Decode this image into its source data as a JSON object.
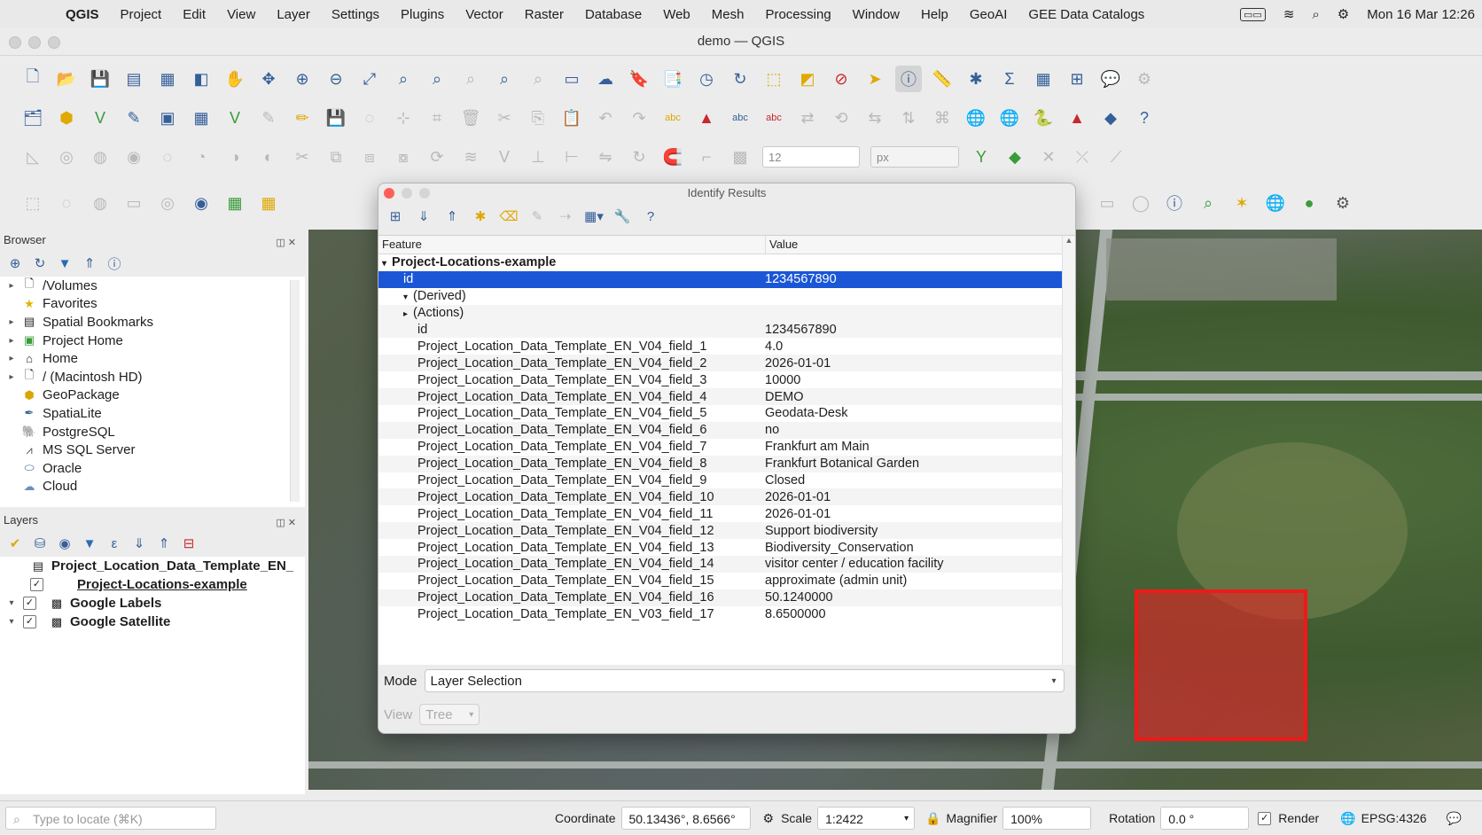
{
  "menubar": {
    "app_name": "QGIS",
    "items": [
      "Project",
      "Edit",
      "View",
      "Layer",
      "Settings",
      "Plugins",
      "Vector",
      "Raster",
      "Database",
      "Web",
      "Mesh",
      "Processing",
      "Window",
      "Help",
      "GeoAI",
      "GEE Data Catalogs"
    ],
    "clock": "Mon 16 Mar  12:26"
  },
  "window": {
    "title": "demo — QGIS"
  },
  "toolbar": {
    "size_value": "12",
    "size_unit": "px"
  },
  "browser": {
    "title": "Browser",
    "items": [
      {
        "label": "/Volumes",
        "icon": "folder-icon",
        "arrow": "▸"
      },
      {
        "label": "Favorites",
        "icon": "star-icon",
        "arrow": ""
      },
      {
        "label": "Spatial Bookmarks",
        "icon": "bookmark-icon",
        "arrow": "▸"
      },
      {
        "label": "Project Home",
        "icon": "project-home-icon",
        "arrow": "▸"
      },
      {
        "label": "Home",
        "icon": "home-icon",
        "arrow": "▸"
      },
      {
        "label": "/ (Macintosh HD)",
        "icon": "folder-icon",
        "arrow": "▸"
      },
      {
        "label": "GeoPackage",
        "icon": "geopackage-icon",
        "arrow": ""
      },
      {
        "label": "SpatiaLite",
        "icon": "spatialite-icon",
        "arrow": ""
      },
      {
        "label": "PostgreSQL",
        "icon": "postgresql-icon",
        "arrow": ""
      },
      {
        "label": "MS SQL Server",
        "icon": "mssql-icon",
        "arrow": ""
      },
      {
        "label": "Oracle",
        "icon": "oracle-icon",
        "arrow": ""
      },
      {
        "label": "Cloud",
        "icon": "cloud-icon",
        "arrow": ""
      }
    ]
  },
  "layers": {
    "title": "Layers",
    "items": [
      {
        "label": "Project_Location_Data_Template_EN_",
        "checked": false,
        "indent": 0
      },
      {
        "label": "Project-Locations-example",
        "checked": true,
        "indent": 1
      },
      {
        "label": "Google Labels",
        "checked": true,
        "indent": 0
      },
      {
        "label": "Google Satellite",
        "checked": true,
        "indent": 0
      }
    ]
  },
  "identify": {
    "title": "Identify Results",
    "col_feature": "Feature",
    "col_value": "Value",
    "layer_name": "Project-Locations-example",
    "selected": {
      "feature": "id",
      "value": "1234567890"
    },
    "derived": "(Derived)",
    "actions": "(Actions)",
    "rows": [
      {
        "feature": "id",
        "value": "1234567890"
      },
      {
        "feature": "Project_Location_Data_Template_EN_V04_field_1",
        "value": "4.0"
      },
      {
        "feature": "Project_Location_Data_Template_EN_V04_field_2",
        "value": "2026-01-01"
      },
      {
        "feature": "Project_Location_Data_Template_EN_V04_field_3",
        "value": "10000"
      },
      {
        "feature": "Project_Location_Data_Template_EN_V04_field_4",
        "value": "DEMO"
      },
      {
        "feature": "Project_Location_Data_Template_EN_V04_field_5",
        "value": "Geodata-Desk"
      },
      {
        "feature": "Project_Location_Data_Template_EN_V04_field_6",
        "value": "no"
      },
      {
        "feature": "Project_Location_Data_Template_EN_V04_field_7",
        "value": "Frankfurt am Main"
      },
      {
        "feature": "Project_Location_Data_Template_EN_V04_field_8",
        "value": "Frankfurt Botanical Garden"
      },
      {
        "feature": "Project_Location_Data_Template_EN_V04_field_9",
        "value": "Closed"
      },
      {
        "feature": "Project_Location_Data_Template_EN_V04_field_10",
        "value": "2026-01-01"
      },
      {
        "feature": "Project_Location_Data_Template_EN_V04_field_11",
        "value": "2026-01-01"
      },
      {
        "feature": "Project_Location_Data_Template_EN_V04_field_12",
        "value": "Support biodiversity"
      },
      {
        "feature": "Project_Location_Data_Template_EN_V04_field_13",
        "value": "Biodiversity_Conservation"
      },
      {
        "feature": "Project_Location_Data_Template_EN_V04_field_14",
        "value": "visitor center / education facility"
      },
      {
        "feature": "Project_Location_Data_Template_EN_V04_field_15",
        "value": "approximate (admin unit)"
      },
      {
        "feature": "Project_Location_Data_Template_EN_V04_field_16",
        "value": "50.1240000"
      },
      {
        "feature": "Project_Location_Data_Template_EN_V03_field_17",
        "value": "8.6500000"
      }
    ],
    "mode_label": "Mode",
    "mode_value": "Layer Selection",
    "view_label": "View",
    "view_value": "Tree"
  },
  "statusbar": {
    "locate_placeholder": "Type to locate (⌘K)",
    "coordinate_label": "Coordinate",
    "coordinate_value": "50.13436°, 8.6566°",
    "scale_label": "Scale",
    "scale_value": "1:2422",
    "magnifier_label": "Magnifier",
    "magnifier_value": "100%",
    "rotation_label": "Rotation",
    "rotation_value": "0.0 °",
    "render_label": "Render",
    "crs": "EPSG:4326"
  },
  "colors": {
    "selection": "#1a56d6",
    "highlight": "#f01818"
  }
}
